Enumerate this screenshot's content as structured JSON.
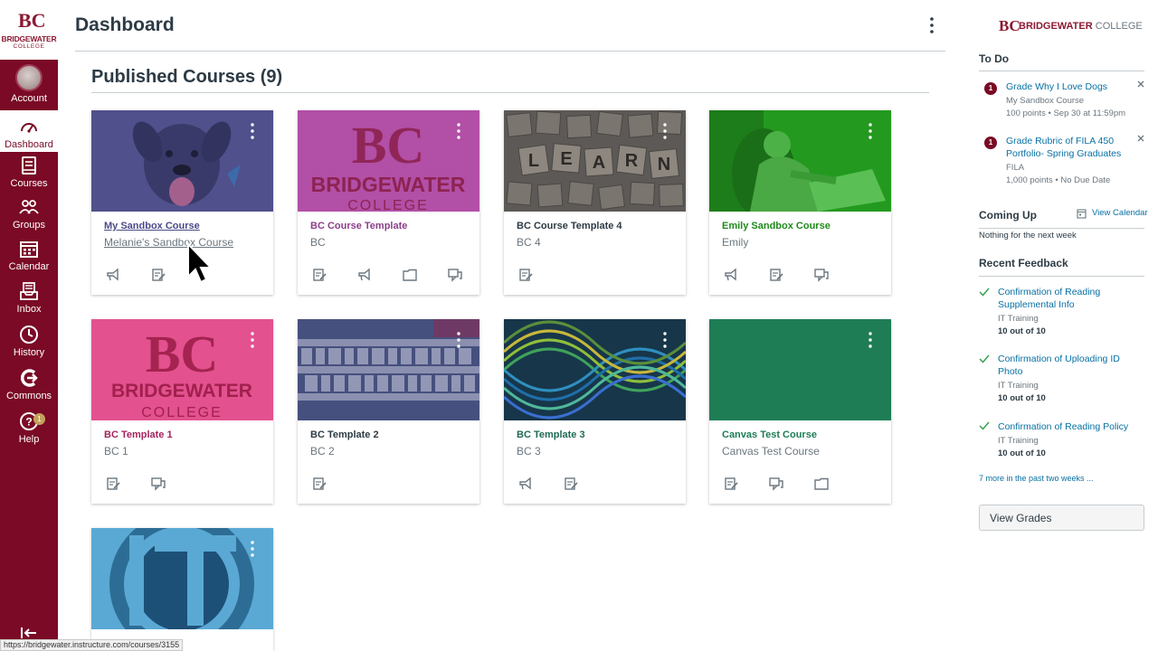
{
  "global_nav": {
    "logo": {
      "mark": "BC",
      "name": "BRIDGEWATER",
      "sub": "COLLEGE"
    },
    "items": [
      {
        "label": "Account",
        "icon": "avatar"
      },
      {
        "label": "Dashboard",
        "icon": "dashboard-icon",
        "active": true
      },
      {
        "label": "Courses",
        "icon": "book-icon"
      },
      {
        "label": "Groups",
        "icon": "groups-icon"
      },
      {
        "label": "Calendar",
        "icon": "calendar-icon"
      },
      {
        "label": "Inbox",
        "icon": "inbox-icon"
      },
      {
        "label": "History",
        "icon": "clock-icon"
      },
      {
        "label": "Commons",
        "icon": "commons-icon"
      },
      {
        "label": "Help",
        "icon": "help-icon",
        "badge": "1"
      }
    ]
  },
  "header": {
    "title": "Dashboard"
  },
  "main": {
    "section_title": "Published Courses (9)",
    "courses": [
      {
        "title": "My Sandbox Course",
        "code": "Melanie's Sandbox Course",
        "color": "#4a4a8a",
        "title_color": "#4a4a8a",
        "hero": "dog"
      },
      {
        "title": "BC Course Template",
        "code": "BC",
        "color": "#b04fa8",
        "title_color": "#8b3f8a",
        "hero": "logo-purple"
      },
      {
        "title": "BC Course Template 4",
        "code": "BC 4",
        "color": "#5e5b59",
        "title_color": "#2d3b45",
        "hero": "learn"
      },
      {
        "title": "Emily Sandbox Course",
        "code": "Emily",
        "color": "#1f8a1c",
        "title_color": "#1f8a1c",
        "hero": "green"
      },
      {
        "title": "BC Template 1",
        "code": "BC 1",
        "color": "#e0508c",
        "title_color": "#a3245d",
        "hero": "logo-pink"
      },
      {
        "title": "BC Template 2",
        "code": "BC 2",
        "color": "#3d4c82",
        "title_color": "#2d3b45",
        "hero": "magazines"
      },
      {
        "title": "BC Template 3",
        "code": "BC 3",
        "color": "#1e6a55",
        "title_color": "#1e6a55",
        "hero": "waves"
      },
      {
        "title": "Canvas Test Course",
        "code": "Canvas Test Course",
        "color": "#1e7d55",
        "title_color": "#1e7d55",
        "hero": "solid"
      },
      {
        "title": "",
        "code": "",
        "color": "#3b8fbf",
        "title_color": "#2d3b45",
        "hero": "it"
      }
    ]
  },
  "sidebar": {
    "logo": {
      "mark": "BC",
      "name_bold": "BRIDGEWATER",
      "name_light": "COLLEGE"
    },
    "todo": {
      "heading": "To Do",
      "items": [
        {
          "num": "1",
          "title": "Grade Why I Love Dogs",
          "course": "My Sandbox Course",
          "meta": "100 points • Sep 30 at 11:59pm"
        },
        {
          "num": "1",
          "title_line1": "Grade Rubric of FILA 450",
          "title_line2": "Portfolio- Spring Graduates",
          "course": "FILA",
          "meta": "1,000 points • No Due Date"
        }
      ]
    },
    "coming_up": {
      "heading": "Coming Up",
      "view_calendar": "View Calendar",
      "empty": "Nothing for the next week"
    },
    "feedback": {
      "heading": "Recent Feedback",
      "items": [
        {
          "line1": "Confirmation of Reading",
          "line2": "Supplemental Info",
          "course": "IT Training",
          "score": "10 out of 10"
        },
        {
          "line1": "Confirmation of Uploading ID",
          "line2": "Photo",
          "course": "IT Training",
          "score": "10 out of 10"
        },
        {
          "line1": "Confirmation of Reading Policy",
          "line2": "",
          "course": "IT Training",
          "score": "10 out of 10"
        }
      ],
      "more": "7 more in the past two weeks ..."
    },
    "view_grades": "View Grades"
  },
  "status_bar": {
    "url": "https://bridgewater.instructure.com/courses/3155"
  }
}
